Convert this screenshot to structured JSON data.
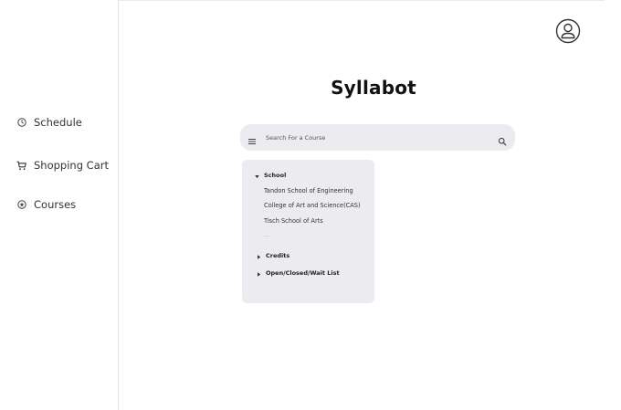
{
  "app": {
    "title": "Syllabot"
  },
  "sidebar": {
    "items": [
      {
        "label": "Schedule",
        "icon": "clock-icon"
      },
      {
        "label": "Shopping Cart",
        "icon": "cart-icon"
      },
      {
        "label": "Courses",
        "icon": "courses-icon"
      }
    ]
  },
  "header": {
    "avatar_icon": "user-avatar-icon"
  },
  "search": {
    "placeholder": "Search For a Course",
    "icon": "search-icon",
    "menu_icon": "menu-icon"
  },
  "filters": {
    "school": {
      "label": "School",
      "expanded": true,
      "options": [
        "Tandon School of Engineering",
        "College of Art and Science(CAS)",
        "Tisch School of Arts"
      ],
      "more": "..."
    },
    "credits": {
      "label": "Credits",
      "expanded": false
    },
    "status": {
      "label": "Open/Closed/Wait List",
      "expanded": false
    }
  }
}
